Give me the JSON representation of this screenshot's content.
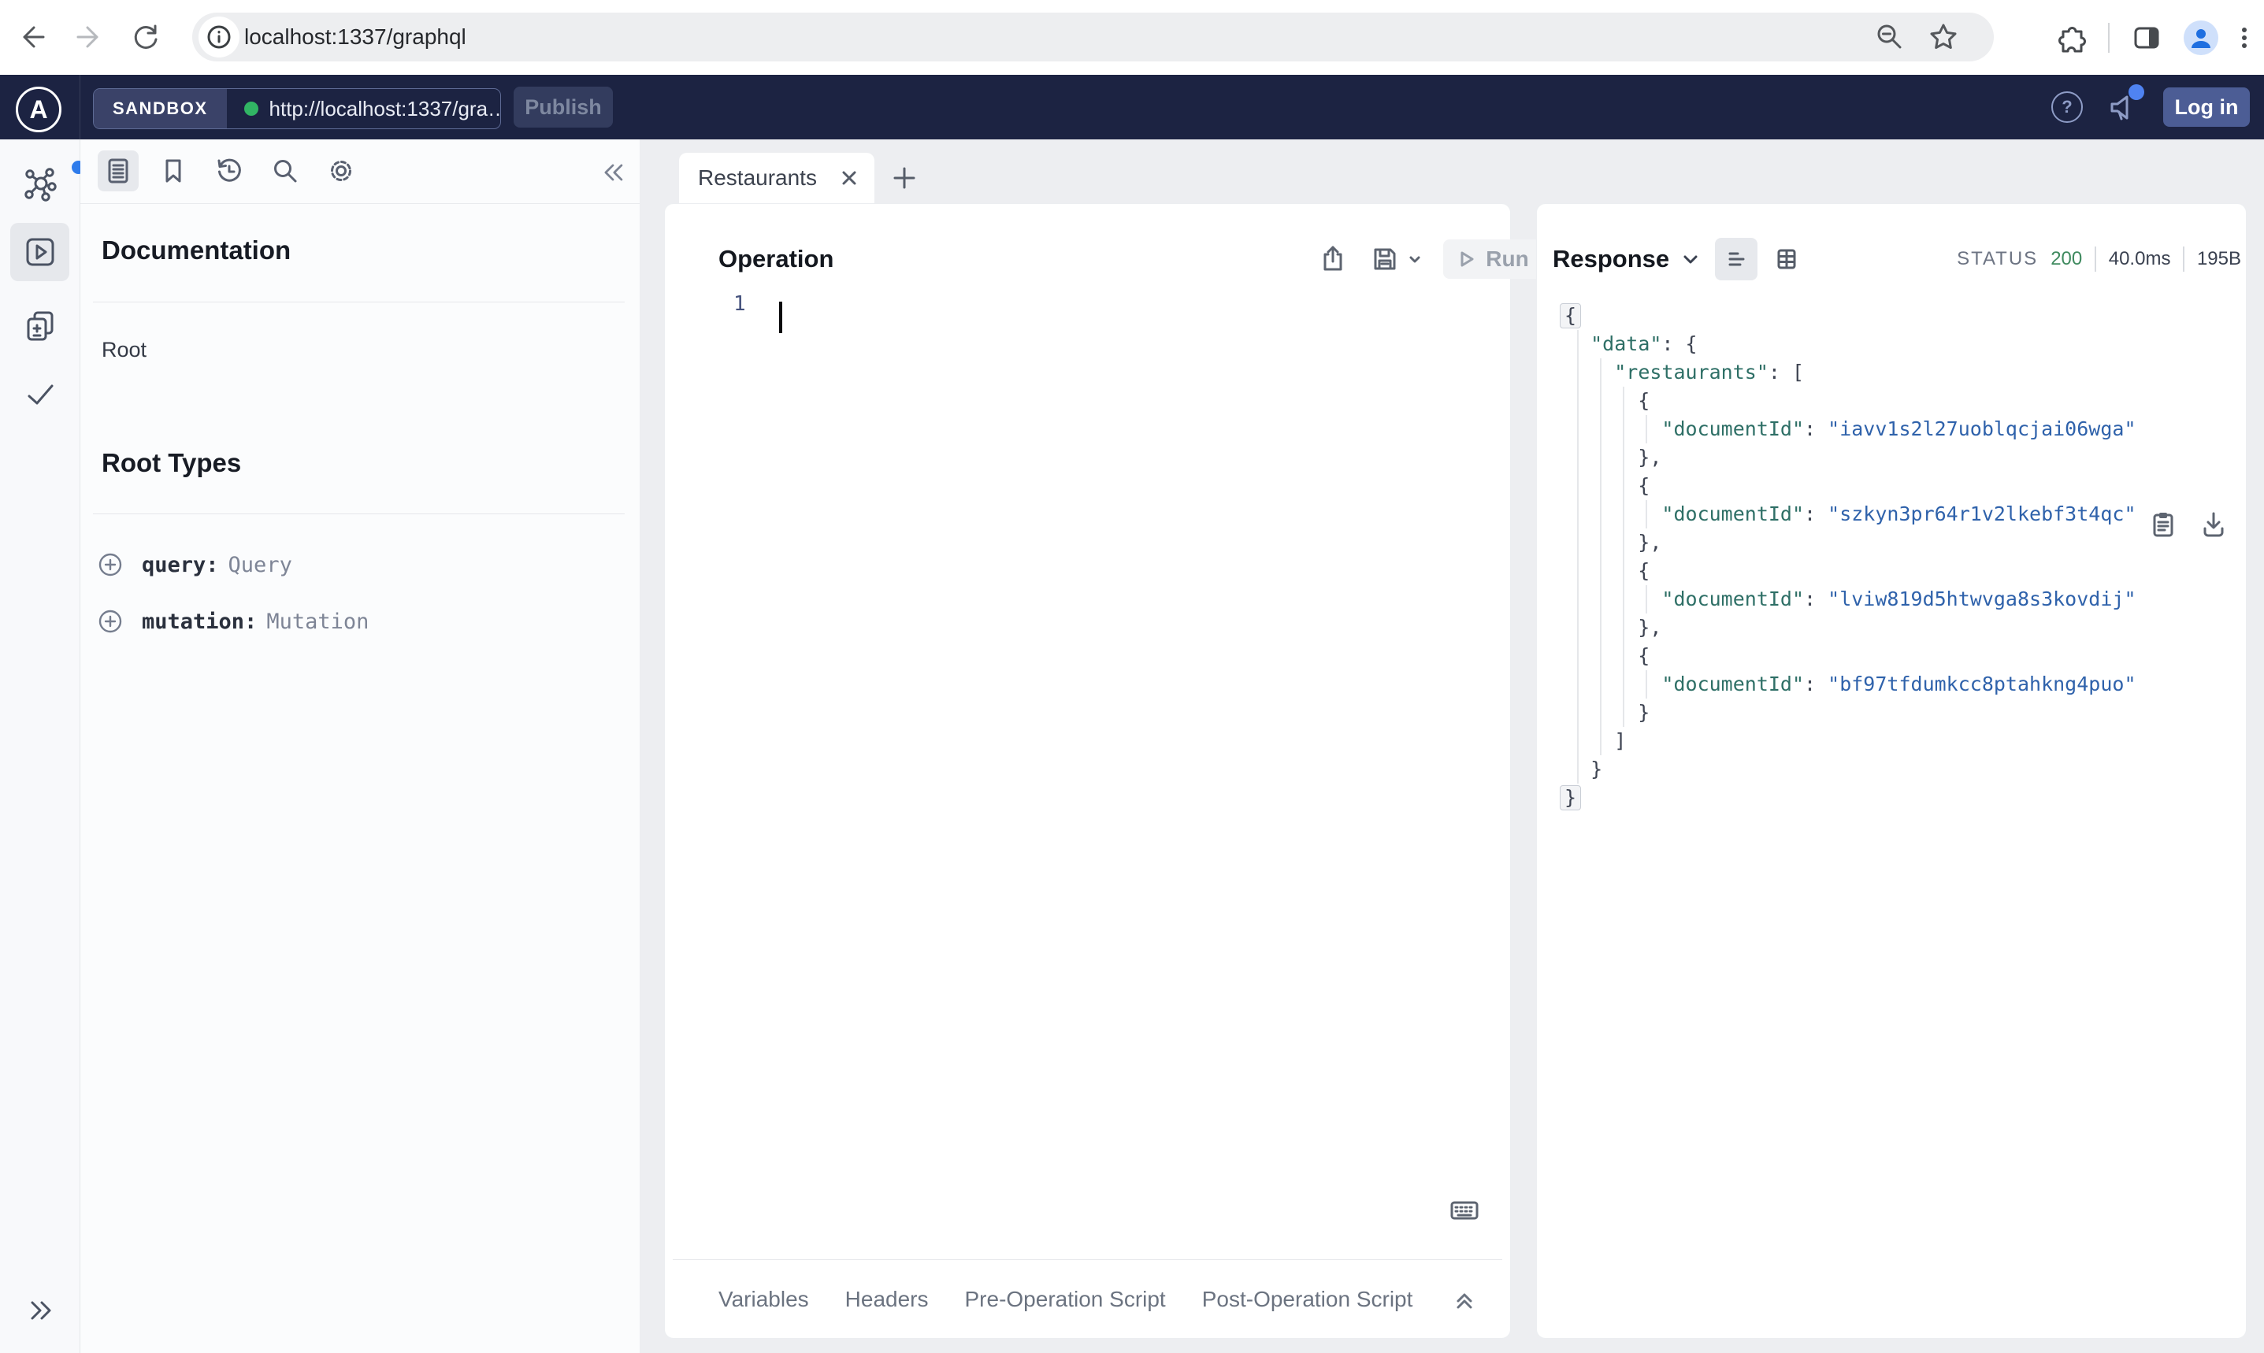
{
  "browser": {
    "url": "localhost:1337/graphql"
  },
  "appbar": {
    "badge": "SANDBOX",
    "endpoint": "http://localhost:1337/gra…",
    "publish_label": "Publish",
    "login_label": "Log in",
    "help_glyph": "?"
  },
  "logo_letter": "A",
  "sidebar": {
    "title": "Documentation",
    "root_label": "Root",
    "section_title": "Root Types",
    "root_types": [
      {
        "name": "query:",
        "type": "Query"
      },
      {
        "name": "mutation:",
        "type": "Mutation"
      }
    ]
  },
  "tabs": {
    "active": "Restaurants"
  },
  "operation": {
    "title": "Operation",
    "run_label": "Run",
    "line_number": "1",
    "footer_tabs": [
      "Variables",
      "Headers",
      "Pre-Operation Script",
      "Post-Operation Script"
    ]
  },
  "response": {
    "title": "Response",
    "status_label": "STATUS",
    "status_code": "200",
    "time": "40.0ms",
    "size": "195B",
    "lines": [
      {
        "fold": true,
        "segs": [
          [
            "p",
            "{"
          ]
        ]
      },
      {
        "segs": [
          [
            "p",
            "  "
          ],
          [
            "k",
            "\"data\""
          ],
          [
            "p",
            ": {"
          ]
        ]
      },
      {
        "segs": [
          [
            "p",
            "    "
          ],
          [
            "k",
            "\"restaurants\""
          ],
          [
            "p",
            ": ["
          ]
        ]
      },
      {
        "segs": [
          [
            "p",
            "      {"
          ]
        ]
      },
      {
        "segs": [
          [
            "p",
            "        "
          ],
          [
            "k",
            "\"documentId\""
          ],
          [
            "p",
            ": "
          ],
          [
            "v",
            "\"iavv1s2l27uoblqcjai06wga\""
          ]
        ]
      },
      {
        "segs": [
          [
            "p",
            "      },"
          ]
        ]
      },
      {
        "segs": [
          [
            "p",
            "      {"
          ]
        ]
      },
      {
        "segs": [
          [
            "p",
            "        "
          ],
          [
            "k",
            "\"documentId\""
          ],
          [
            "p",
            ": "
          ],
          [
            "v",
            "\"szkyn3pr64r1v2lkebf3t4qc\""
          ]
        ]
      },
      {
        "segs": [
          [
            "p",
            "      },"
          ]
        ]
      },
      {
        "segs": [
          [
            "p",
            "      {"
          ]
        ]
      },
      {
        "segs": [
          [
            "p",
            "        "
          ],
          [
            "k",
            "\"documentId\""
          ],
          [
            "p",
            ": "
          ],
          [
            "v",
            "\"lviw819d5htwvga8s3kovdij\""
          ]
        ]
      },
      {
        "segs": [
          [
            "p",
            "      },"
          ]
        ]
      },
      {
        "segs": [
          [
            "p",
            "      {"
          ]
        ]
      },
      {
        "segs": [
          [
            "p",
            "        "
          ],
          [
            "k",
            "\"documentId\""
          ],
          [
            "p",
            ": "
          ],
          [
            "v",
            "\"bf97tfdumkcc8ptahkng4puo\""
          ]
        ]
      },
      {
        "segs": [
          [
            "p",
            "      }"
          ]
        ]
      },
      {
        "segs": [
          [
            "p",
            "    ]"
          ]
        ]
      },
      {
        "segs": [
          [
            "p",
            "  }"
          ]
        ]
      },
      {
        "fold": true,
        "segs": [
          [
            "p",
            "}"
          ]
        ]
      }
    ]
  },
  "colors": {
    "header_bg": "#1c2342",
    "accent_blue": "#2f7ceb",
    "notification_dot": "#4f83f2",
    "sandbox_dot": "#31b564",
    "login_bg": "#4c5d95",
    "status_green": "#3f8a5f",
    "json_key": "#2e6f66",
    "json_value": "#2f62ab"
  }
}
